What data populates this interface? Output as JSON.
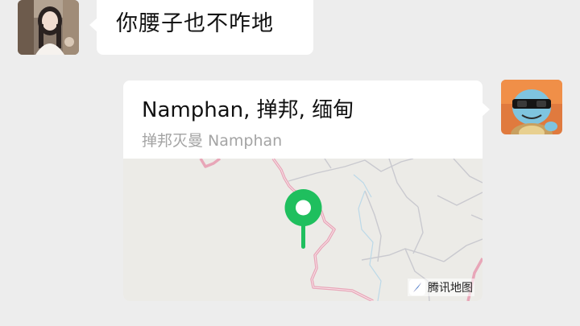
{
  "messages": [
    {
      "sender": "contact",
      "type": "text",
      "text": "你腰子也不咋地"
    },
    {
      "sender": "self",
      "type": "location",
      "title": "Namphan, 掸邦, 缅甸",
      "subtitle": "掸邦灭曼 Namphan",
      "map_provider": "腾讯地图"
    }
  ],
  "colors": {
    "background": "#ededed",
    "bubble": "#ffffff",
    "pin": "#1fbf5e",
    "border_line": "#e8a6b8",
    "road": "#c9c9cf",
    "river": "#bcd9e8",
    "map_bg": "#ecebe7"
  },
  "icons": {
    "contact_avatar": "woman-photo-avatar",
    "self_avatar": "squirtle-sunglasses-avatar",
    "pin": "location-pin-icon",
    "brand": "tencent-map-compass-icon"
  }
}
